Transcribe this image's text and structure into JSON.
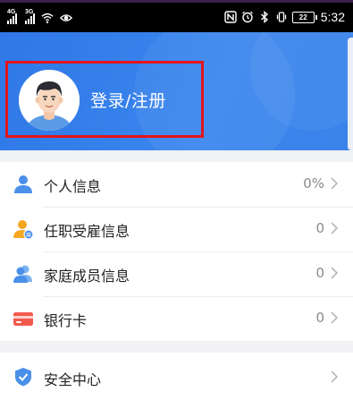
{
  "status_bar": {
    "signal_tag_1": "4G",
    "signal_tag_2": "3G",
    "battery_level": "22",
    "time": "5:32"
  },
  "header": {
    "login_label": "登录/注册"
  },
  "menu": {
    "items": [
      {
        "label": "个人信息",
        "value": "0%",
        "icon": "person-icon"
      },
      {
        "label": "任职受雇信息",
        "value": "0",
        "icon": "employment-icon"
      },
      {
        "label": "家庭成员信息",
        "value": "0",
        "icon": "family-icon"
      },
      {
        "label": "银行卡",
        "value": "0",
        "icon": "bank-card-icon"
      }
    ]
  },
  "security": {
    "label": "安全中心",
    "icon": "shield-icon"
  },
  "colors": {
    "primary_blue": "#3a83ea",
    "highlight_red": "#e4141b",
    "icon_blue": "#4a90e8",
    "icon_orange": "#f5a623",
    "card_red": "#f25a4d"
  }
}
